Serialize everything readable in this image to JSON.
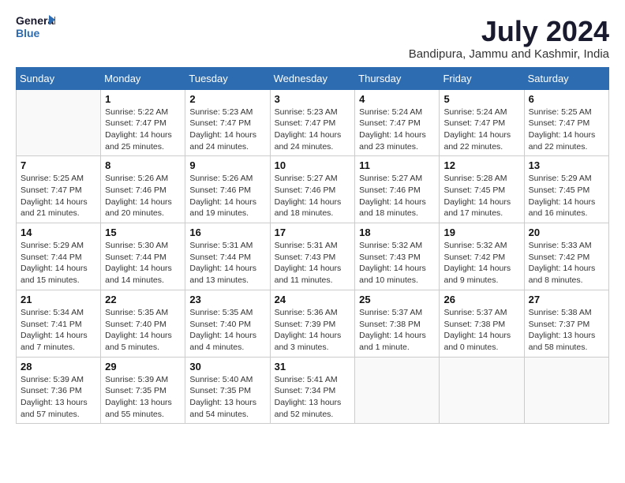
{
  "logo": {
    "line1": "General",
    "line2": "Blue"
  },
  "title": {
    "month_year": "July 2024",
    "location": "Bandipura, Jammu and Kashmir, India"
  },
  "headers": [
    "Sunday",
    "Monday",
    "Tuesday",
    "Wednesday",
    "Thursday",
    "Friday",
    "Saturday"
  ],
  "weeks": [
    [
      {
        "day": "",
        "info": ""
      },
      {
        "day": "1",
        "info": "Sunrise: 5:22 AM\nSunset: 7:47 PM\nDaylight: 14 hours\nand 25 minutes."
      },
      {
        "day": "2",
        "info": "Sunrise: 5:23 AM\nSunset: 7:47 PM\nDaylight: 14 hours\nand 24 minutes."
      },
      {
        "day": "3",
        "info": "Sunrise: 5:23 AM\nSunset: 7:47 PM\nDaylight: 14 hours\nand 24 minutes."
      },
      {
        "day": "4",
        "info": "Sunrise: 5:24 AM\nSunset: 7:47 PM\nDaylight: 14 hours\nand 23 minutes."
      },
      {
        "day": "5",
        "info": "Sunrise: 5:24 AM\nSunset: 7:47 PM\nDaylight: 14 hours\nand 22 minutes."
      },
      {
        "day": "6",
        "info": "Sunrise: 5:25 AM\nSunset: 7:47 PM\nDaylight: 14 hours\nand 22 minutes."
      }
    ],
    [
      {
        "day": "7",
        "info": "Sunrise: 5:25 AM\nSunset: 7:47 PM\nDaylight: 14 hours\nand 21 minutes."
      },
      {
        "day": "8",
        "info": "Sunrise: 5:26 AM\nSunset: 7:46 PM\nDaylight: 14 hours\nand 20 minutes."
      },
      {
        "day": "9",
        "info": "Sunrise: 5:26 AM\nSunset: 7:46 PM\nDaylight: 14 hours\nand 19 minutes."
      },
      {
        "day": "10",
        "info": "Sunrise: 5:27 AM\nSunset: 7:46 PM\nDaylight: 14 hours\nand 18 minutes."
      },
      {
        "day": "11",
        "info": "Sunrise: 5:27 AM\nSunset: 7:46 PM\nDaylight: 14 hours\nand 18 minutes."
      },
      {
        "day": "12",
        "info": "Sunrise: 5:28 AM\nSunset: 7:45 PM\nDaylight: 14 hours\nand 17 minutes."
      },
      {
        "day": "13",
        "info": "Sunrise: 5:29 AM\nSunset: 7:45 PM\nDaylight: 14 hours\nand 16 minutes."
      }
    ],
    [
      {
        "day": "14",
        "info": "Sunrise: 5:29 AM\nSunset: 7:44 PM\nDaylight: 14 hours\nand 15 minutes."
      },
      {
        "day": "15",
        "info": "Sunrise: 5:30 AM\nSunset: 7:44 PM\nDaylight: 14 hours\nand 14 minutes."
      },
      {
        "day": "16",
        "info": "Sunrise: 5:31 AM\nSunset: 7:44 PM\nDaylight: 14 hours\nand 13 minutes."
      },
      {
        "day": "17",
        "info": "Sunrise: 5:31 AM\nSunset: 7:43 PM\nDaylight: 14 hours\nand 11 minutes."
      },
      {
        "day": "18",
        "info": "Sunrise: 5:32 AM\nSunset: 7:43 PM\nDaylight: 14 hours\nand 10 minutes."
      },
      {
        "day": "19",
        "info": "Sunrise: 5:32 AM\nSunset: 7:42 PM\nDaylight: 14 hours\nand 9 minutes."
      },
      {
        "day": "20",
        "info": "Sunrise: 5:33 AM\nSunset: 7:42 PM\nDaylight: 14 hours\nand 8 minutes."
      }
    ],
    [
      {
        "day": "21",
        "info": "Sunrise: 5:34 AM\nSunset: 7:41 PM\nDaylight: 14 hours\nand 7 minutes."
      },
      {
        "day": "22",
        "info": "Sunrise: 5:35 AM\nSunset: 7:40 PM\nDaylight: 14 hours\nand 5 minutes."
      },
      {
        "day": "23",
        "info": "Sunrise: 5:35 AM\nSunset: 7:40 PM\nDaylight: 14 hours\nand 4 minutes."
      },
      {
        "day": "24",
        "info": "Sunrise: 5:36 AM\nSunset: 7:39 PM\nDaylight: 14 hours\nand 3 minutes."
      },
      {
        "day": "25",
        "info": "Sunrise: 5:37 AM\nSunset: 7:38 PM\nDaylight: 14 hours\nand 1 minute."
      },
      {
        "day": "26",
        "info": "Sunrise: 5:37 AM\nSunset: 7:38 PM\nDaylight: 14 hours\nand 0 minutes."
      },
      {
        "day": "27",
        "info": "Sunrise: 5:38 AM\nSunset: 7:37 PM\nDaylight: 13 hours\nand 58 minutes."
      }
    ],
    [
      {
        "day": "28",
        "info": "Sunrise: 5:39 AM\nSunset: 7:36 PM\nDaylight: 13 hours\nand 57 minutes."
      },
      {
        "day": "29",
        "info": "Sunrise: 5:39 AM\nSunset: 7:35 PM\nDaylight: 13 hours\nand 55 minutes."
      },
      {
        "day": "30",
        "info": "Sunrise: 5:40 AM\nSunset: 7:35 PM\nDaylight: 13 hours\nand 54 minutes."
      },
      {
        "day": "31",
        "info": "Sunrise: 5:41 AM\nSunset: 7:34 PM\nDaylight: 13 hours\nand 52 minutes."
      },
      {
        "day": "",
        "info": ""
      },
      {
        "day": "",
        "info": ""
      },
      {
        "day": "",
        "info": ""
      }
    ]
  ]
}
